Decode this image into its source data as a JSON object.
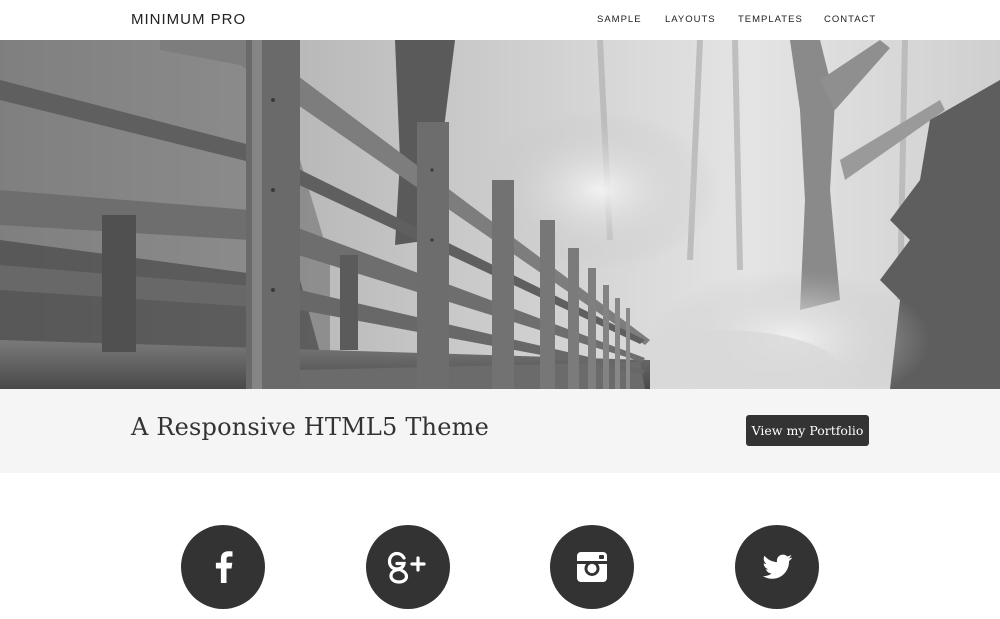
{
  "header": {
    "site_title": "MINIMUM PRO",
    "nav": [
      {
        "label": "SAMPLE"
      },
      {
        "label": "LAYOUTS"
      },
      {
        "label": "TEMPLATES"
      },
      {
        "label": "CONTACT"
      }
    ]
  },
  "hero": {
    "image": "black-and-white photo of a wooden bridge railing in a misty forest"
  },
  "tagline": {
    "text": "A Responsive HTML5 Theme",
    "button_label": "View my Portfolio"
  },
  "social": [
    {
      "name": "Facebook",
      "icon": "facebook-icon"
    },
    {
      "name": "Google+",
      "icon": "google-plus-icon"
    },
    {
      "name": "Instagram",
      "icon": "instagram-icon"
    },
    {
      "name": "Twitter",
      "icon": "twitter-icon"
    }
  ],
  "colors": {
    "text": "#333333",
    "band_background": "#f5f5f5",
    "button_background": "#333333",
    "button_text": "#ffffff",
    "social_circle": "#333333"
  }
}
